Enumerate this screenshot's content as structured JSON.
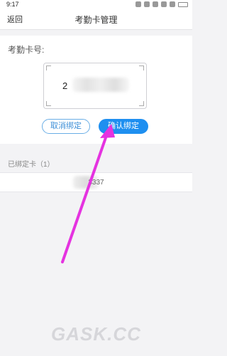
{
  "status_bar": {
    "time": "9:17"
  },
  "nav": {
    "back_label": "返回",
    "title": "考勤卡管理"
  },
  "card": {
    "label": "考勤卡号:",
    "number_visible": "2"
  },
  "buttons": {
    "cancel_label": "取消绑定",
    "confirm_label": "确认绑定"
  },
  "bound": {
    "title": "已绑定卡（1）",
    "number_visible": "3337"
  },
  "watermark": {
    "text": "GASK.CC"
  },
  "colors": {
    "accent": "#1e8ff0",
    "arrow": "#e533e0",
    "background": "#f3f3f5"
  },
  "icons": [
    "bluetooth-icon",
    "alarm-icon",
    "mute-icon",
    "signal-icon",
    "wifi-icon",
    "battery-icon"
  ]
}
